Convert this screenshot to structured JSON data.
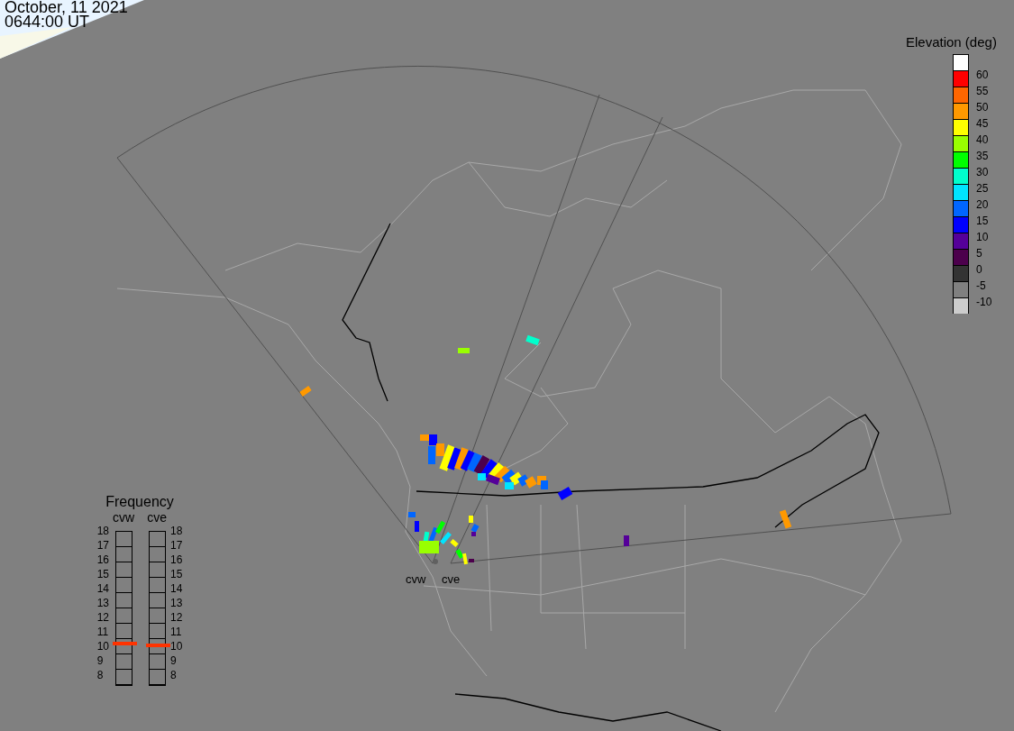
{
  "header": {
    "date": "October, 11 2021",
    "time": "0644:00 UT"
  },
  "legend": {
    "title": "Elevation (deg)",
    "colors": [
      {
        "color": "#ffffff"
      },
      {
        "color": "#ff0000"
      },
      {
        "color": "#ff6600"
      },
      {
        "color": "#ff9900"
      },
      {
        "color": "#ffff00"
      },
      {
        "color": "#99ff00"
      },
      {
        "color": "#00ff00"
      },
      {
        "color": "#00ffcc"
      },
      {
        "color": "#00e5ff"
      },
      {
        "color": "#0066ff"
      },
      {
        "color": "#0000ff"
      },
      {
        "color": "#550099"
      },
      {
        "color": "#4c004c"
      },
      {
        "color": "#333333"
      },
      {
        "color": "#808080"
      },
      {
        "color": "#cccccc"
      }
    ],
    "labels": [
      "60",
      "55",
      "50",
      "45",
      "40",
      "35",
      "30",
      "25",
      "20",
      "15",
      "10",
      "5",
      "0",
      "-5",
      "-10"
    ]
  },
  "map": {
    "radar_labels": [
      "cvw",
      "cve"
    ]
  },
  "frequency": {
    "title": "Frequency",
    "radars": [
      {
        "name": "cvw",
        "level": 0.27,
        "ticks": [
          "18",
          "17",
          "16",
          "15",
          "14",
          "13",
          "12",
          "11",
          "10",
          "9",
          "8"
        ]
      },
      {
        "name": "cve",
        "level": 0.26,
        "ticks": [
          "18",
          "17",
          "16",
          "15",
          "14",
          "13",
          "12",
          "11",
          "10",
          "9",
          "8"
        ]
      }
    ]
  }
}
